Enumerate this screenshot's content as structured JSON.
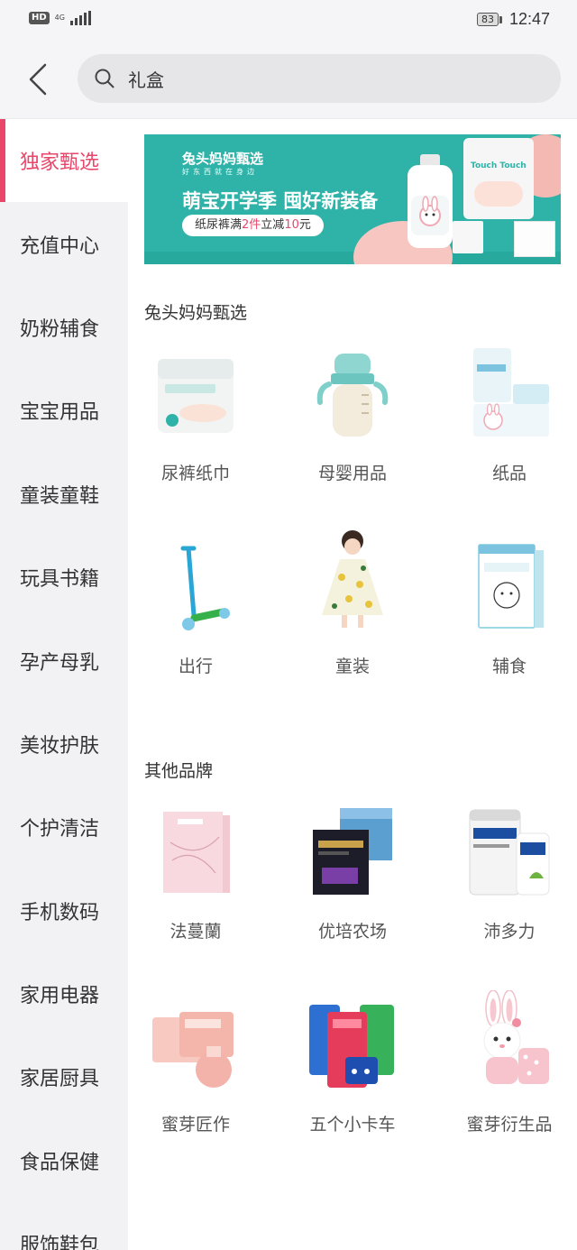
{
  "status_bar": {
    "hd": "HD",
    "network": "4G",
    "battery": "83",
    "time": "12:47"
  },
  "search": {
    "query": "礼盒"
  },
  "sidebar": {
    "items": [
      {
        "label": "独家甄选"
      },
      {
        "label": "充值中心"
      },
      {
        "label": "奶粉辅食"
      },
      {
        "label": "宝宝用品"
      },
      {
        "label": "童装童鞋"
      },
      {
        "label": "玩具书籍"
      },
      {
        "label": "孕产母乳"
      },
      {
        "label": "美妆护肤"
      },
      {
        "label": "个护清洁"
      },
      {
        "label": "手机数码"
      },
      {
        "label": "家用电器"
      },
      {
        "label": "家居厨具"
      },
      {
        "label": "食品保健"
      },
      {
        "label": "服饰鞋包"
      }
    ]
  },
  "banner": {
    "brand": "兔头妈妈甄选",
    "subtitle": "好东西就在身边",
    "headline": "萌宝开学季 囤好新装备",
    "promo_prefix": "纸尿裤满",
    "promo_count": "2件",
    "promo_mid": "立减",
    "promo_amount": "10",
    "promo_suffix": "元",
    "product_label": "Touch Touch"
  },
  "sections": [
    {
      "title": "兔头妈妈甄选",
      "items": [
        {
          "label": "尿裤纸巾",
          "icon": "diaper-pack-icon"
        },
        {
          "label": "母婴用品",
          "icon": "baby-bottle-icon"
        },
        {
          "label": "纸品",
          "icon": "tissue-pack-icon"
        },
        {
          "label": "出行",
          "icon": "scooter-icon"
        },
        {
          "label": "童装",
          "icon": "child-dress-icon"
        },
        {
          "label": "辅食",
          "icon": "baby-food-box-icon"
        }
      ]
    },
    {
      "title": "其他品牌",
      "items": [
        {
          "label": "法蔓蘭",
          "icon": "cosmetic-box-icon"
        },
        {
          "label": "优培农场",
          "icon": "supplement-box-icon"
        },
        {
          "label": "沛多力",
          "icon": "milk-can-icon"
        },
        {
          "label": "蜜芽匠作",
          "icon": "towel-set-icon"
        },
        {
          "label": "五个小卡车",
          "icon": "wipes-stack-icon"
        },
        {
          "label": "蜜芽衍生品",
          "icon": "bunny-plush-icon"
        }
      ]
    }
  ],
  "colors": {
    "accent": "#e8476a",
    "banner": "#2fb3a8"
  }
}
